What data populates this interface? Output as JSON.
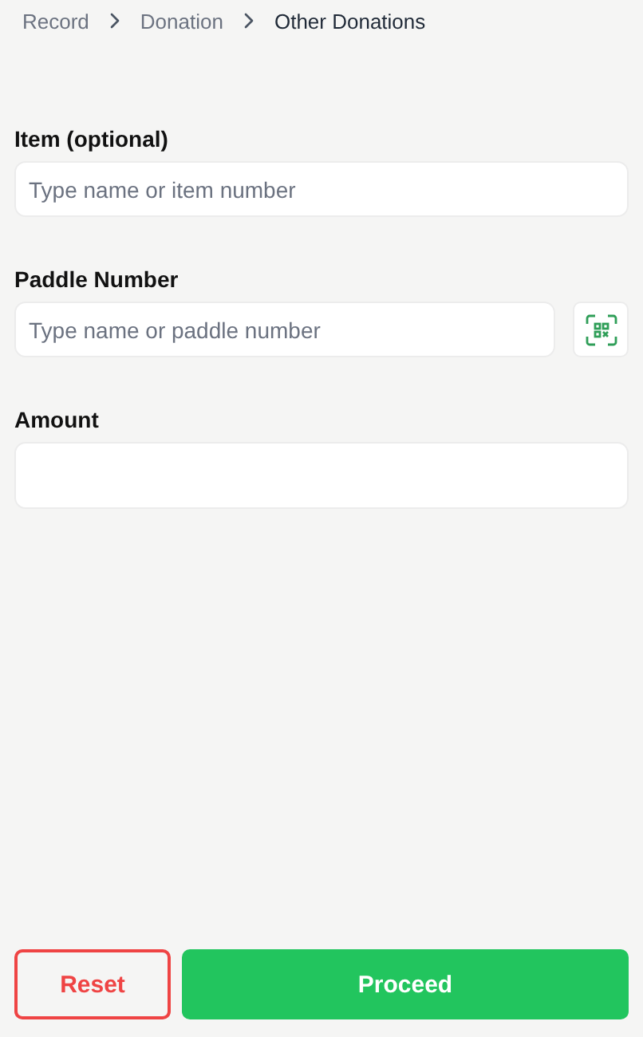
{
  "breadcrumb": [
    {
      "label": "Record",
      "current": false
    },
    {
      "label": "Donation",
      "current": false
    },
    {
      "label": "Other Donations",
      "current": true
    }
  ],
  "fields": [
    {
      "label": "Item (optional)",
      "placeholder": "Type name or item number",
      "kind": "text"
    },
    {
      "label": "Paddle Number",
      "placeholder": "Type name or paddle number",
      "kind": "scan"
    },
    {
      "label": "Amount",
      "kind": "tall"
    }
  ],
  "buttons": [
    {
      "label": "Reset",
      "kind": "danger"
    },
    {
      "label": "Proceed",
      "kind": "primary"
    }
  ]
}
